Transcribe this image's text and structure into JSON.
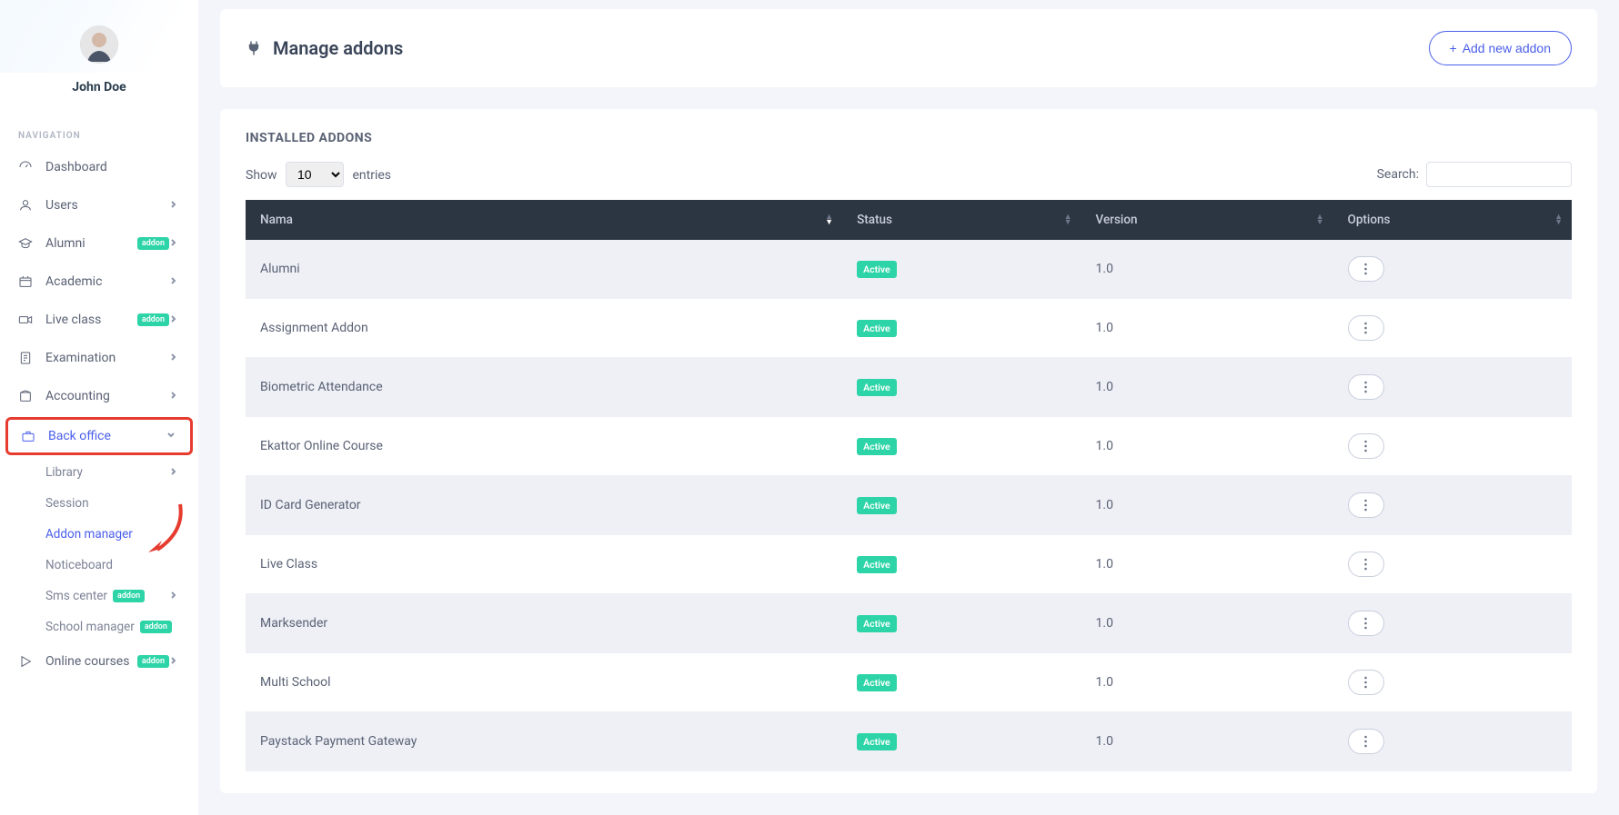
{
  "user": {
    "name": "John Doe"
  },
  "sidebar": {
    "heading": "NAVIGATION",
    "items": [
      {
        "label": "Dashboard",
        "icon": "dashboard",
        "chevron": false
      },
      {
        "label": "Users",
        "icon": "users",
        "chevron": true
      },
      {
        "label": "Alumni",
        "icon": "alumni",
        "chevron": true,
        "badge": "addon"
      },
      {
        "label": "Academic",
        "icon": "academic",
        "chevron": true
      },
      {
        "label": "Live class",
        "icon": "video",
        "chevron": true,
        "badge": "addon"
      },
      {
        "label": "Examination",
        "icon": "exam",
        "chevron": true
      },
      {
        "label": "Accounting",
        "icon": "accounting",
        "chevron": true
      },
      {
        "label": "Back office",
        "icon": "briefcase",
        "chevron": "down",
        "active": true,
        "highlight": true
      },
      {
        "label": "Online courses",
        "icon": "play",
        "chevron": true,
        "badge": "addon"
      }
    ],
    "backoffice_sub": [
      {
        "label": "Library",
        "chevron": true
      },
      {
        "label": "Session"
      },
      {
        "label": "Addon manager",
        "active": true
      },
      {
        "label": "Noticeboard"
      },
      {
        "label": "Sms center",
        "badge": "addon",
        "chevron": true
      },
      {
        "label": "School manager",
        "badge": "addon"
      }
    ]
  },
  "header": {
    "title": "Manage addons",
    "add_btn": "Add new addon"
  },
  "table_card": {
    "title": "INSTALLED ADDONS",
    "show_label_pre": "Show",
    "show_value": "10",
    "show_label_post": "entries",
    "search_label": "Search:",
    "columns": {
      "name": "Nama",
      "status": "Status",
      "version": "Version",
      "options": "Options"
    },
    "rows": [
      {
        "name": "Alumni",
        "status": "Active",
        "version": "1.0"
      },
      {
        "name": "Assignment Addon",
        "status": "Active",
        "version": "1.0"
      },
      {
        "name": "Biometric Attendance",
        "status": "Active",
        "version": "1.0"
      },
      {
        "name": "Ekattor Online Course",
        "status": "Active",
        "version": "1.0"
      },
      {
        "name": "ID Card Generator",
        "status": "Active",
        "version": "1.0"
      },
      {
        "name": "Live Class",
        "status": "Active",
        "version": "1.0"
      },
      {
        "name": "Marksender",
        "status": "Active",
        "version": "1.0"
      },
      {
        "name": "Multi School",
        "status": "Active",
        "version": "1.0"
      },
      {
        "name": "Paystack Payment Gateway",
        "status": "Active",
        "version": "1.0"
      }
    ]
  }
}
